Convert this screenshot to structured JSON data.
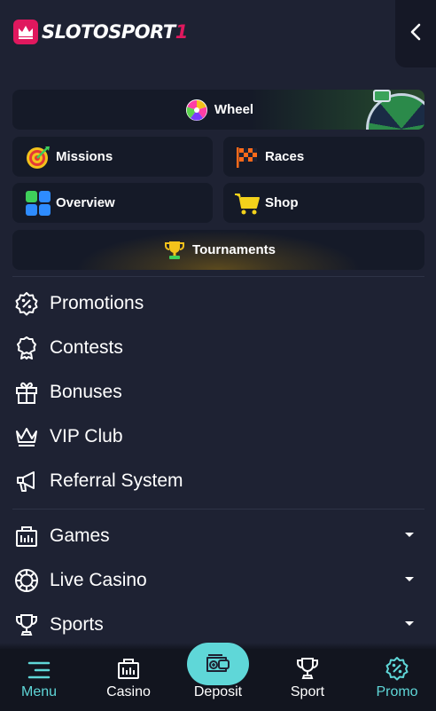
{
  "brand": {
    "name_part1": "SLOTOSPORT",
    "name_part2": "1",
    "accent_color": "#e0185e"
  },
  "header": {
    "close_icon": "chevron-left-icon"
  },
  "tiles": {
    "wheel": {
      "label": "Wheel",
      "icon": "fortune-wheel-icon"
    },
    "missions": {
      "label": "Missions",
      "icon": "target-icon"
    },
    "races": {
      "label": "Races",
      "icon": "racing-flag-icon"
    },
    "overview": {
      "label": "Overview",
      "icon": "grid-icon"
    },
    "shop": {
      "label": "Shop",
      "icon": "cart-icon"
    },
    "tournaments": {
      "label": "Tournaments",
      "icon": "trophy-icon"
    }
  },
  "promo_menu": [
    {
      "label": "Promotions",
      "icon": "percent-badge-icon"
    },
    {
      "label": "Contests",
      "icon": "ribbon-icon"
    },
    {
      "label": "Bonuses",
      "icon": "gift-icon"
    },
    {
      "label": "VIP Club",
      "icon": "crown-icon"
    },
    {
      "label": "Referral System",
      "icon": "megaphone-icon"
    }
  ],
  "category_menu": [
    {
      "label": "Games",
      "icon": "slot-machine-icon",
      "expandable": true
    },
    {
      "label": "Live Casino",
      "icon": "casino-chip-icon",
      "expandable": true
    },
    {
      "label": "Sports",
      "icon": "trophy-outline-icon",
      "expandable": true
    }
  ],
  "bottom_nav": {
    "menu": {
      "label": "Menu",
      "icon": "hamburger-icon",
      "active": true
    },
    "casino": {
      "label": "Casino",
      "icon": "slot-machine-icon"
    },
    "deposit": {
      "label": "Deposit",
      "icon": "wallet-plus-icon"
    },
    "sport": {
      "label": "Sport",
      "icon": "trophy-outline-icon"
    },
    "promo": {
      "label": "Promo",
      "icon": "percent-badge-icon",
      "active": true
    }
  },
  "colors": {
    "background": "#1e2233",
    "tile_bg": "#151a28",
    "active_nav": "#5fd7d8"
  }
}
